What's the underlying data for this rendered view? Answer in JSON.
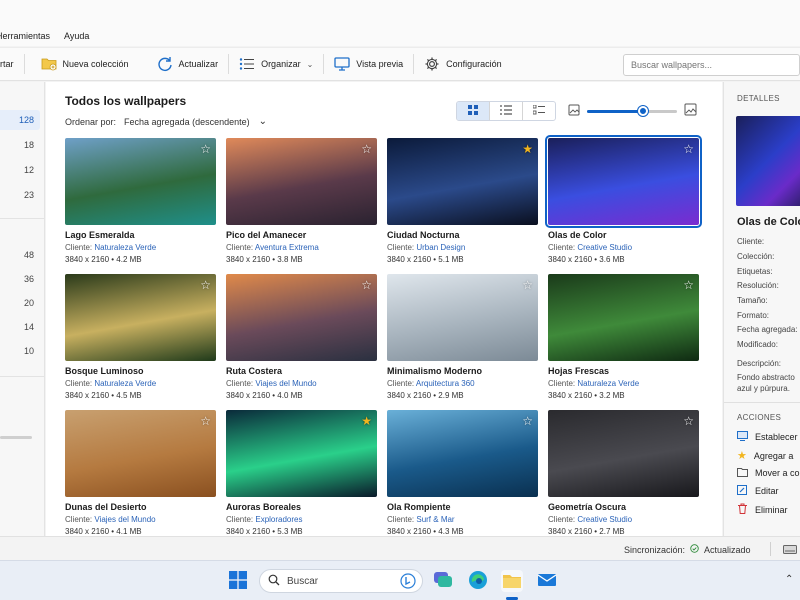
{
  "menu": {
    "herramientas": "Herramientas",
    "ayuda": "Ayuda"
  },
  "toolbar": {
    "partial": "rtar",
    "new_collection": "Nueva colección",
    "refresh": "Actualizar",
    "organize": "Organizar",
    "preview": "Vista previa",
    "settings": "Configuración",
    "search_placeholder": "Buscar wallpapers..."
  },
  "sidebar": {
    "counts": [
      "128",
      "18",
      "12",
      "23",
      "48",
      "36",
      "20",
      "14",
      "10"
    ]
  },
  "main": {
    "title": "Todos los wallpapers",
    "sort_label": "Ordenar por:",
    "sort_value": "Fecha agregada  (descendente)",
    "zoom_level": 0.62
  },
  "wallpapers": [
    {
      "name": "Lago Esmeralda",
      "client_label": "Cliente:",
      "client": "Naturaleza Verde",
      "res": "3840 x 2160",
      "size": "4.2 MB",
      "fav": false,
      "colors": [
        "#6fa0c8",
        "#2f6a3d",
        "#1f8f8a"
      ]
    },
    {
      "name": "Pico del Amanecer",
      "client_label": "Cliente:",
      "client": "Aventura Extrema",
      "res": "3840 x 2160",
      "size": "3.8 MB",
      "fav": false,
      "colors": [
        "#e08a5a",
        "#5a3a4a",
        "#2a2230"
      ]
    },
    {
      "name": "Ciudad Nocturna",
      "client_label": "Cliente:",
      "client": "Urban Design",
      "res": "3840 x 2160",
      "size": "5.1 MB",
      "fav": true,
      "colors": [
        "#0b1a3a",
        "#2b4a8a",
        "#0a0f1f"
      ]
    },
    {
      "name": "Olas de Color",
      "client_label": "Cliente:",
      "client": "Creative Studio",
      "res": "3840 x 2160",
      "size": "3.6 MB",
      "fav": false,
      "colors": [
        "#1a1f5a",
        "#3a4ee0",
        "#7a2bd0"
      ]
    },
    {
      "name": "Bosque Luminoso",
      "client_label": "Cliente:",
      "client": "Naturaleza Verde",
      "res": "3840 x 2160",
      "size": "4.5 MB",
      "fav": false,
      "colors": [
        "#2a3a1a",
        "#c8b060",
        "#1f3a1a"
      ]
    },
    {
      "name": "Ruta Costera",
      "client_label": "Cliente:",
      "client": "Viajes del Mundo",
      "res": "3840 x 2160",
      "size": "4.0 MB",
      "fav": false,
      "colors": [
        "#e08a4a",
        "#6a4a5a",
        "#2a3040"
      ]
    },
    {
      "name": "Minimalismo Moderno",
      "client_label": "Cliente:",
      "client": "Arquitectura 360",
      "res": "3840 x 2160",
      "size": "2.9 MB",
      "fav": false,
      "colors": [
        "#dfe6ec",
        "#a8b4be",
        "#7c8a96"
      ]
    },
    {
      "name": "Hojas Frescas",
      "client_label": "Cliente:",
      "client": "Naturaleza Verde",
      "res": "3840 x 2160",
      "size": "3.2 MB",
      "fav": false,
      "colors": [
        "#1a3a1a",
        "#3f8a3a",
        "#0f2a12"
      ]
    },
    {
      "name": "Dunas del Desierto",
      "client_label": "Cliente:",
      "client": "Viajes del Mundo",
      "res": "3840 x 2160",
      "size": "4.1 MB",
      "fav": false,
      "colors": [
        "#c8a070",
        "#b57a40",
        "#8a5020"
      ]
    },
    {
      "name": "Auroras Boreales",
      "client_label": "Cliente:",
      "client": "Exploradores",
      "res": "3840 x 2160",
      "size": "5.3 MB",
      "fav": true,
      "colors": [
        "#0a2a3a",
        "#2ad08a",
        "#0a1a2a"
      ]
    },
    {
      "name": "Ola Rompiente",
      "client_label": "Cliente:",
      "client": "Surf & Mar",
      "res": "3840 x 2160",
      "size": "4.3 MB",
      "fav": false,
      "colors": [
        "#6ab0d8",
        "#1a5a8a",
        "#0a3050"
      ]
    },
    {
      "name": "Geometría Oscura",
      "client_label": "Cliente:",
      "client": "Creative Studio",
      "res": "3840 x 2160",
      "size": "2.7 MB",
      "fav": false,
      "colors": [
        "#2a2a2e",
        "#4a4a50",
        "#18181c"
      ]
    }
  ],
  "details": {
    "header": "DETALLES",
    "title": "Olas de Color",
    "fields": [
      "Cliente:",
      "Colección:",
      "Etiquetas:",
      "Resolución:",
      "Tamaño:",
      "Formato:",
      "Fecha agregada:",
      "Modificado:"
    ],
    "description_label": "Descripción:",
    "description": [
      "Fondo abstracto",
      "azul y púrpura."
    ],
    "actions_header": "ACCIONES",
    "actions": [
      "Establecer",
      "Agregar a",
      "Mover a co",
      "Editar",
      "Eliminar"
    ]
  },
  "status": {
    "sync_label": "Sincronización:",
    "sync_value": "Actualizado"
  },
  "taskbar": {
    "search_placeholder": "Buscar"
  },
  "colors": {
    "accent": "#0f62c7",
    "link": "#2b63b8",
    "favorite": "#f2b51e",
    "danger": "#d13438"
  }
}
